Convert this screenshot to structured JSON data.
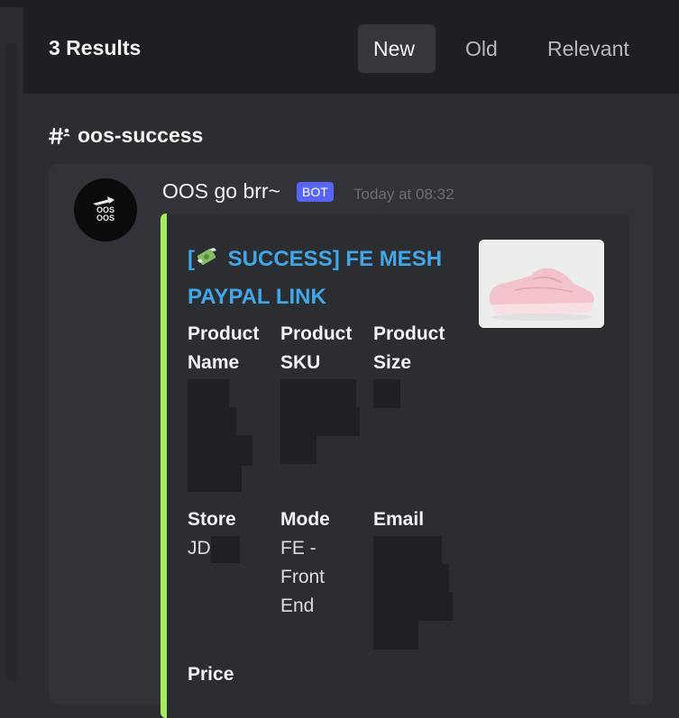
{
  "header": {
    "results_title": "3 Results",
    "tabs": [
      {
        "label": "New",
        "active": true
      },
      {
        "label": "Old",
        "active": false
      },
      {
        "label": "Relevant",
        "active": false
      }
    ]
  },
  "channel": {
    "name": "oos-success",
    "icon": "threads-channel-icon"
  },
  "message": {
    "author": "OOS go brr~",
    "badge": "BOT",
    "timestamp": "Today at 08:32",
    "avatar_text": "OOS",
    "embed": {
      "accent_color": "#a6ec5f",
      "title_prefix": "[",
      "title_icon": "money-with-wings-icon",
      "title_text": " SUCCESS] FE MESH PAYPAL LINK",
      "thumbnail": "pink-sneaker-image",
      "fields": [
        {
          "name_line1": "Product",
          "name_line2": "Name",
          "value": ""
        },
        {
          "name_line1": "Product",
          "name_line2": "SKU",
          "value": ""
        },
        {
          "name_line1": "Product",
          "name_line2": "Size",
          "value": ""
        },
        {
          "name_line1": "Store",
          "name_line2": "",
          "value": "JD"
        },
        {
          "name_line1": "Mode",
          "name_line2": "",
          "value_lines": [
            "FE -",
            "Front",
            "End"
          ]
        },
        {
          "name_line1": "Email",
          "name_line2": "",
          "value": ""
        },
        {
          "name_line1": "Price",
          "name_line2": "",
          "value": ""
        }
      ]
    }
  },
  "colors": {
    "background": "#2b2d31",
    "header": "#1e1f22",
    "card": "#313338",
    "link_blue": "#41a6e8",
    "bot_badge": "#5865f2"
  }
}
